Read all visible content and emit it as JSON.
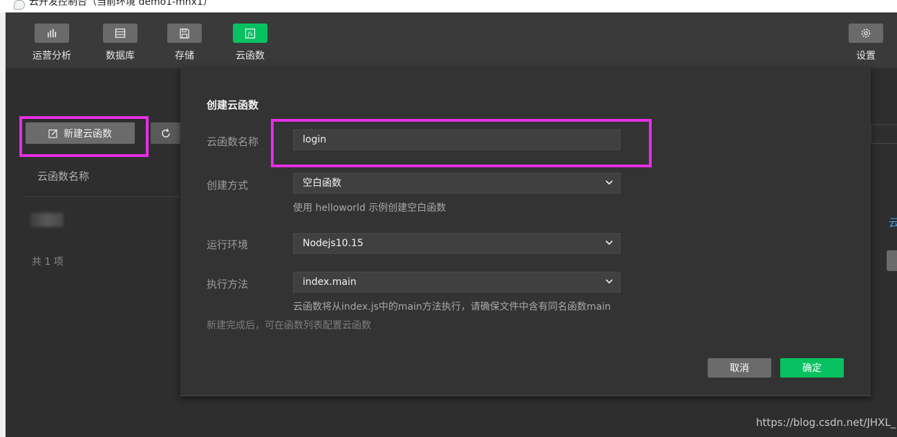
{
  "window": {
    "title": "云开发控制台（当前环境 demo1-mhx1）"
  },
  "toolbar": {
    "items": [
      {
        "label": "运营分析",
        "icon": "bar-chart-icon",
        "active": false
      },
      {
        "label": "数据库",
        "icon": "database-icon",
        "active": false
      },
      {
        "label": "存储",
        "icon": "save-icon",
        "active": false
      },
      {
        "label": "云函数",
        "icon": "function-icon",
        "active": true
      }
    ],
    "settings": {
      "label": "设置",
      "icon": "gear-icon"
    }
  },
  "page": {
    "new_button": "新建云函数",
    "column_header": "云函数名称",
    "count": "共 1 项",
    "right_link": "云"
  },
  "modal": {
    "title": "创建云函数",
    "name_label": "云函数名称",
    "name_value": "login",
    "create_label": "创建方式",
    "create_value": "空白函数",
    "create_hint": "使用 helloworld 示例创建空白函数",
    "env_label": "运行环境",
    "env_value": "Nodejs10.15",
    "exec_label": "执行方法",
    "exec_value": "index.main",
    "exec_hint": "云函数将从index.js中的main方法执行，请确保文件中含有同名函数main",
    "footnote": "新建完成后，可在函数列表配置云函数",
    "cancel": "取消",
    "confirm": "确定"
  },
  "watermark": "https://blog.csdn.net/JHXL_",
  "colors": {
    "accent": "#07c160",
    "highlight": "#e62ee6",
    "link": "#3aa0e8"
  }
}
